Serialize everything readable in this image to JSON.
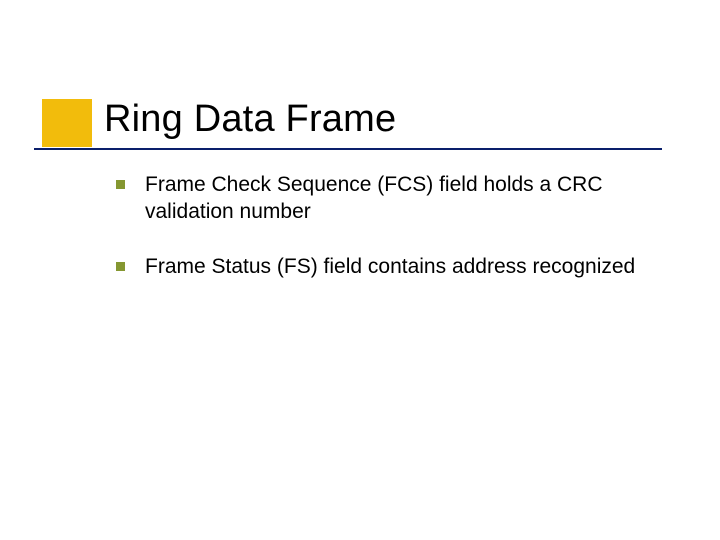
{
  "slide": {
    "title": "Ring Data Frame",
    "bullets": [
      {
        "text": "Frame Check Sequence (FCS) field holds a CRC validation number"
      },
      {
        "text": "Frame Status (FS) field contains address recognized"
      }
    ]
  }
}
